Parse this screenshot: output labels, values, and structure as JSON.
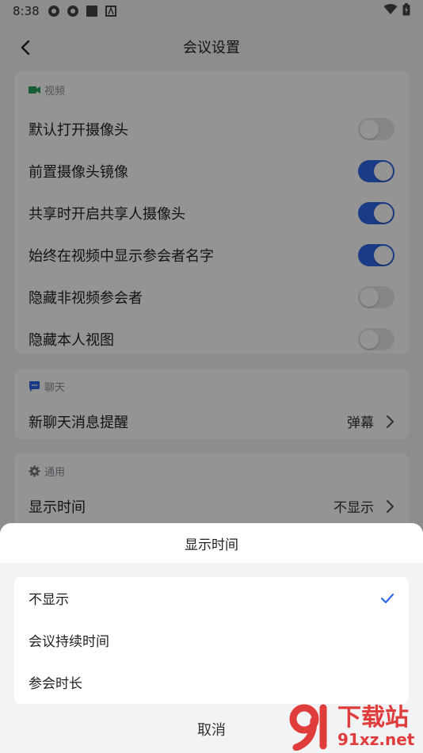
{
  "status_bar": {
    "time": "8:38"
  },
  "header": {
    "title": "会议设置"
  },
  "video_section": {
    "title": "视频",
    "items": [
      {
        "label": "默认打开摄像头",
        "on": false
      },
      {
        "label": "前置摄像头镜像",
        "on": true
      },
      {
        "label": "共享时开启共享人摄像头",
        "on": true
      },
      {
        "label": "始终在视频中显示参会者名字",
        "on": true
      },
      {
        "label": "隐藏非视频参会者",
        "on": false
      },
      {
        "label": "隐藏本人视图",
        "on": false
      }
    ]
  },
  "chat_section": {
    "title": "聊天",
    "item_label": "新聊天消息提醒",
    "item_value": "弹幕"
  },
  "general_section": {
    "title": "通用",
    "item_label": "显示时间",
    "item_value": "不显示"
  },
  "sheet": {
    "title": "显示时间",
    "options": [
      {
        "label": "不显示",
        "selected": true
      },
      {
        "label": "会议持续时间",
        "selected": false
      },
      {
        "label": "参会时长",
        "selected": false
      }
    ],
    "cancel_label": "取消"
  },
  "watermark": {
    "top_text": "下载站",
    "bottom_text": "91xz.net"
  },
  "colors": {
    "toggle_on": "#2e66e6",
    "check": "#2e66e6",
    "video_icon": "#2aa35a",
    "chat_icon": "#2e66e6"
  }
}
